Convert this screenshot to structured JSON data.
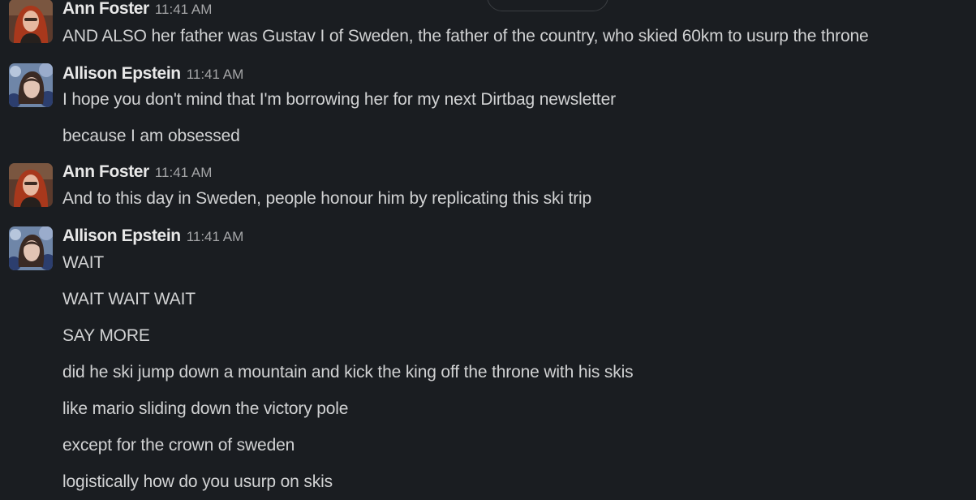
{
  "messages": [
    {
      "author": "Ann Foster",
      "time": "11:41 AM",
      "avatar": "ann-foster-avatar",
      "lines": [
        "AND ALSO her father was Gustav I of Sweden, the father of the country, who skied 60km to usurp the throne"
      ]
    },
    {
      "author": "Allison Epstein",
      "time": "11:41 AM",
      "avatar": "allison-epstein-avatar",
      "lines": [
        "I hope you don't mind that I'm borrowing her for my next Dirtbag newsletter",
        "because I am obsessed"
      ]
    },
    {
      "author": "Ann Foster",
      "time": "11:41 AM",
      "avatar": "ann-foster-avatar",
      "lines": [
        "And to this day in Sweden, people honour him by replicating this ski trip"
      ]
    },
    {
      "author": "Allison Epstein",
      "time": "11:41 AM",
      "avatar": "allison-epstein-avatar",
      "lines": [
        "WAIT",
        "WAIT WAIT WAIT",
        "SAY MORE",
        "did he ski jump down a mountain and kick the king off the throne with his skis",
        "like mario sliding down the victory pole",
        "except for the crown of sweden",
        "logistically how do you usurp on skis"
      ]
    }
  ],
  "colors": {
    "background": "#1a1d21",
    "text": "#d1d2d3",
    "author": "#e8e8e8",
    "timestamp": "#a5a6a8"
  }
}
